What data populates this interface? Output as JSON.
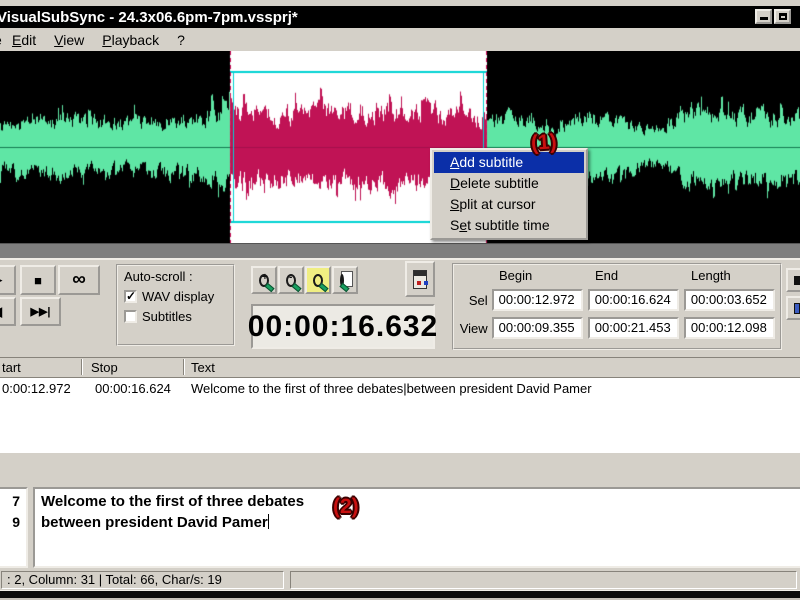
{
  "window": {
    "title": "VisualSubSync - 24.3x06.6pm-7pm.vssprj*",
    "title_bar_buttons": [
      "minimize",
      "maximize"
    ]
  },
  "menu_bar": {
    "clipped_item": "e",
    "items": [
      {
        "label": "Edit",
        "underline": 0
      },
      {
        "label": "View",
        "underline": 0
      },
      {
        "label": "Playback",
        "underline": 0
      },
      {
        "label": "?",
        "underline": -1
      }
    ]
  },
  "waveform": {
    "bg": "#000000",
    "wave_color": "#5fe6a5",
    "center_line": "#157a52",
    "selection": {
      "bg": "#ffffff",
      "wave_color": "#c01355",
      "center_line": "#a50f4c",
      "start_frac": 0.2875,
      "end_frac": 0.6088,
      "marker_color": "#00d2d2",
      "border_color": "#d81060"
    }
  },
  "context_menu": {
    "annotation": "(1)",
    "highlighted_index": 0,
    "items": [
      {
        "label": "Add subtitle",
        "underline": 0
      },
      {
        "label": "Delete subtitle",
        "underline": 0
      },
      {
        "label": "Split at cursor",
        "underline": 0
      },
      {
        "label": "Set subtitle time",
        "underline": 1
      }
    ]
  },
  "icons": {
    "play": "▶",
    "stop": "■",
    "loop": "∞",
    "skip_back": "◀",
    "skip_forward": "▶▶|",
    "check": "✓",
    "zoom_toolbar": [
      "zoom-in",
      "zoom-out",
      "zoom-selection",
      "zoom-all",
      "scene-edit"
    ]
  },
  "autoscroll": {
    "group_label": "Auto-scroll :",
    "wav_display": {
      "label": "WAV display",
      "checked": true
    },
    "subtitles": {
      "label": "Subtitles",
      "checked": false
    }
  },
  "time_display": {
    "value": "00:00:16.632"
  },
  "selection_panel": {
    "col_headers": [
      "Begin",
      "End",
      "Length"
    ],
    "rows": [
      {
        "label": "Sel",
        "begin": "00:00:12.972",
        "end": "00:00:16.624",
        "length": "00:00:03.652"
      },
      {
        "label": "View",
        "begin": "00:00:09.355",
        "end": "00:00:21.453",
        "length": "00:00:12.098"
      }
    ]
  },
  "subtitle_list": {
    "columns": [
      "tart",
      "Stop",
      "Text"
    ],
    "rows": [
      {
        "start": "0:00:12.972",
        "stop": "00:00:16.624",
        "text": "Welcome to the first of three debates|between president David Pamer"
      }
    ]
  },
  "editor": {
    "char_counts": [
      "7",
      "9"
    ],
    "lines": [
      "Welcome to the first of three debates",
      "between president David Pamer"
    ],
    "annotation": "(2)"
  },
  "status_bar": {
    "left": ": 2, Column: 31 | Total: 66, Char/s: 19",
    "right": ""
  },
  "annotation_color": "#c81010"
}
